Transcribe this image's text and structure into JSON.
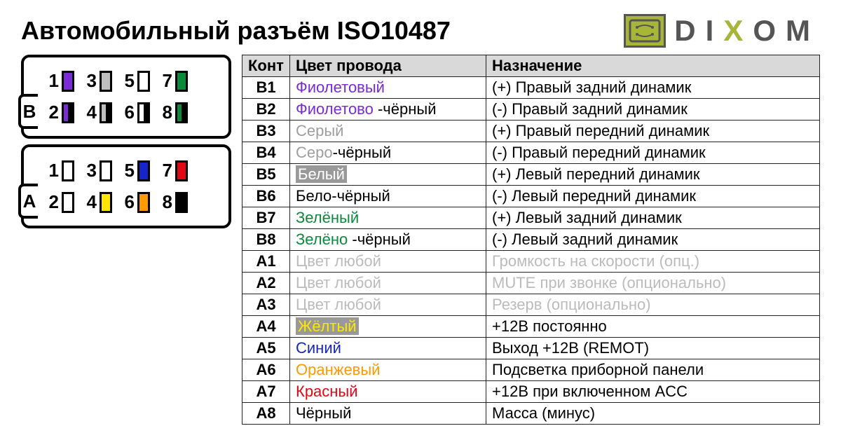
{
  "title": "Автомобильный разъём ISO10487",
  "logo": {
    "d": "D",
    "i": "I",
    "x": "X",
    "o": "O",
    "m": "M"
  },
  "connectorB": {
    "label": "B",
    "row1": [
      {
        "n": "1",
        "color": "#7b2bd6",
        "half": false
      },
      {
        "n": "3",
        "color": "#bfbfbf",
        "half": false
      },
      {
        "n": "5",
        "color": "#ffffff",
        "half": false
      },
      {
        "n": "7",
        "color": "#0a8a3a",
        "half": false
      }
    ],
    "row2": [
      {
        "n": "2",
        "color": "#7b2bd6",
        "half": true
      },
      {
        "n": "4",
        "color": "#bfbfbf",
        "half": true
      },
      {
        "n": "6",
        "color": "#ffffff",
        "half": true
      },
      {
        "n": "8",
        "color": "#0a8a3a",
        "half": true
      }
    ]
  },
  "connectorA": {
    "label": "A",
    "row1": [
      {
        "n": "1",
        "color": "#ffffff",
        "half": false
      },
      {
        "n": "3",
        "color": "#ffffff",
        "half": false
      },
      {
        "n": "5",
        "color": "#1525c9",
        "half": false
      },
      {
        "n": "7",
        "color": "#e30613",
        "half": false
      }
    ],
    "row2": [
      {
        "n": "2",
        "color": "#ffffff",
        "half": false
      },
      {
        "n": "4",
        "color": "#ffe600",
        "half": false
      },
      {
        "n": "6",
        "color": "#ff9900",
        "half": false
      },
      {
        "n": "8",
        "color": "#000000",
        "half": false
      }
    ]
  },
  "headers": {
    "pin": "Конт",
    "color": "Цвет провода",
    "desc": "Назначение"
  },
  "rows": [
    {
      "pin": "B1",
      "color_parts": [
        {
          "t": "Фиолетовый",
          "c": "#7b2bd6"
        }
      ],
      "desc": "(+) Правый задний динамик"
    },
    {
      "pin": "B2",
      "color_parts": [
        {
          "t": "Фиолетово",
          "c": "#7b2bd6"
        },
        {
          "t": " -чёрный",
          "c": "#000"
        }
      ],
      "desc": "(-)  Правый задний динамик"
    },
    {
      "pin": "B3",
      "color_parts": [
        {
          "t": "Серый",
          "c": "#9e9e9e"
        }
      ],
      "desc": "(+) Правый передний динамик"
    },
    {
      "pin": "B4",
      "color_parts": [
        {
          "t": "Серо",
          "c": "#9e9e9e"
        },
        {
          "t": "-чёрный",
          "c": "#000"
        }
      ],
      "desc": "(-)  Правый передний динамик"
    },
    {
      "pin": "B5",
      "color_parts": [
        {
          "t": "Белый",
          "c": "#fff",
          "hl": true
        }
      ],
      "desc": "(+) Левый передний динамик"
    },
    {
      "pin": "B6",
      "color_parts": [
        {
          "t": "Бело-чёрный",
          "c": "#000"
        }
      ],
      "desc": "(-)  Левый передний динамик"
    },
    {
      "pin": "B7",
      "color_parts": [
        {
          "t": "Зелёный",
          "c": "#0a8a3a"
        }
      ],
      "desc": "(+) Левый задний динамик"
    },
    {
      "pin": "B8",
      "color_parts": [
        {
          "t": "Зелёно",
          "c": "#0a8a3a"
        },
        {
          "t": " -чёрный",
          "c": "#000"
        }
      ],
      "desc": "(-)  Левый задний динамик"
    },
    {
      "pin": "A1",
      "color_parts": [
        {
          "t": "Цвет любой",
          "c": "#bbb"
        }
      ],
      "desc": "Громкость на скорости (опц.)",
      "faded": true
    },
    {
      "pin": "A2",
      "color_parts": [
        {
          "t": "Цвет любой",
          "c": "#bbb"
        }
      ],
      "desc": "MUTE при звонке (опционально)",
      "faded": true
    },
    {
      "pin": "A3",
      "color_parts": [
        {
          "t": "Цвет любой",
          "c": "#bbb"
        }
      ],
      "desc": "Резерв (опционально)",
      "faded": true
    },
    {
      "pin": "A4",
      "color_parts": [
        {
          "t": "Жёлтый",
          "c": "#ffe600",
          "hl": true
        }
      ],
      "desc": "+12В постоянно"
    },
    {
      "pin": "A5",
      "color_parts": [
        {
          "t": "Синий",
          "c": "#1525c9"
        }
      ],
      "desc": "Выход +12В (REMOT)"
    },
    {
      "pin": "A6",
      "color_parts": [
        {
          "t": "Оранжевый",
          "c": "#ff9900"
        }
      ],
      "desc": "Подсветка приборной панели"
    },
    {
      "pin": "A7",
      "color_parts": [
        {
          "t": "Красный",
          "c": "#e30613"
        }
      ],
      "desc": "+12В при включенном ACC"
    },
    {
      "pin": "A8",
      "color_parts": [
        {
          "t": "Чёрный",
          "c": "#000"
        }
      ],
      "desc": "Масса (минус)"
    }
  ]
}
